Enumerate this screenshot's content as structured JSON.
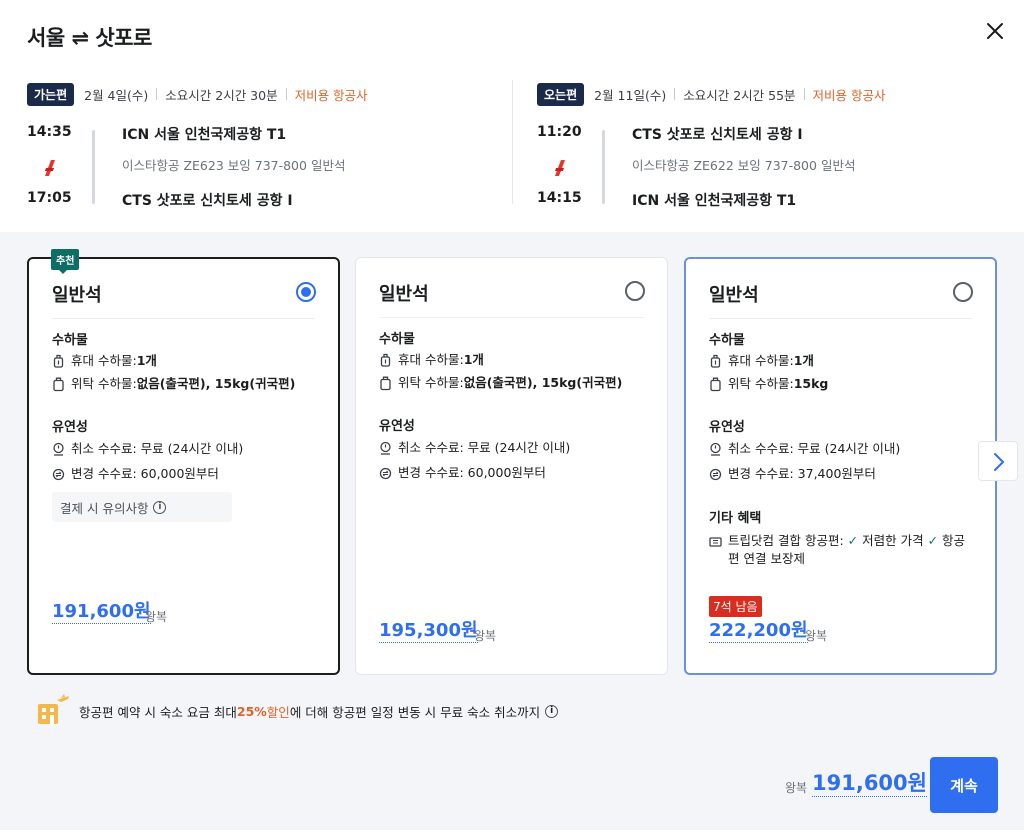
{
  "header": {
    "title": "서울 ⇌ 삿포로",
    "close_icon": "close-icon"
  },
  "outbound": {
    "badge": "가는편",
    "date": "2월 4일(수)",
    "duration": "소요시간 2시간 30분",
    "airline_type": "저비용 항공사",
    "dep_time": "14:35",
    "arr_time": "17:05",
    "dep_airport": "ICN 서울 인천국제공항 T1",
    "arr_airport": "CTS 삿포로 신치토세 공항 I",
    "flight_info": "이스타항공  ZE623  보잉 737-800  일반석"
  },
  "inbound": {
    "badge": "오는편",
    "date": "2월 11일(수)",
    "duration": "소요시간 2시간 55분",
    "airline_type": "저비용 항공사",
    "dep_time": "11:20",
    "arr_time": "14:15",
    "dep_airport": "CTS 삿포로 신치토세 공항 I",
    "arr_airport": "ICN 서울 인천국제공항 T1",
    "flight_info": "이스타항공  ZE622  보잉 737-800  일반석"
  },
  "fares": [
    {
      "recommended_tag": "추천",
      "title": "일반석",
      "selected": true,
      "baggage_title": "수하물",
      "carry_on_label": "휴대 수하물: ",
      "carry_on_value": "1개",
      "checked_label": "위탁 수하물: ",
      "checked_value": "없음(출국편), 15kg(귀국편)",
      "flex_title": "유연성",
      "cancel_fee": "취소 수수료: 무료 (24시간 이내)",
      "change_fee": "변경 수수료: 60,000원부터",
      "note": "결제 시 유의사항",
      "price": "191,600원",
      "price_sub": "왕복"
    },
    {
      "title": "일반석",
      "selected": false,
      "baggage_title": "수하물",
      "carry_on_label": "휴대 수하물: ",
      "carry_on_value": "1개",
      "checked_label": "위탁 수하물: ",
      "checked_value": "없음(출국편), 15kg(귀국편)",
      "flex_title": "유연성",
      "cancel_fee": "취소 수수료: 무료 (24시간 이내)",
      "change_fee": "변경 수수료: 60,000원부터",
      "price": "195,300원",
      "price_sub": "왕복"
    },
    {
      "title": "일반석",
      "selected": false,
      "baggage_title": "수하물",
      "carry_on_label": "휴대 수하물: ",
      "carry_on_value": "1개",
      "checked_label": "위탁 수하물: ",
      "checked_value": "15kg",
      "flex_title": "유연성",
      "cancel_fee": "취소 수수료: 무료 (24시간 이내)",
      "change_fee": "변경 수수료: 37,400원부터",
      "extra_title": "기타 혜택",
      "extra_prefix": "트립닷컴 결합 항공편: ",
      "extra_b1": "저렴한 가격",
      "extra_b2": "항공편 연결 보장제",
      "seats_left": "7석 남음",
      "price": "222,200원",
      "price_sub": "왕복"
    }
  ],
  "promo": {
    "pre": "항공편 예약 시 숙소 요금 최대 ",
    "pct": "25%",
    "mid": " 할인",
    "post": "에 더해 항공편 일정 변동 시 무료 숙소 취소까지"
  },
  "footer": {
    "total_label": "왕복",
    "total_price": "191,600원",
    "cta_label": "계속"
  },
  "colors": {
    "accent": "#2f6fef",
    "lowcost": "#e0642a",
    "recommended": "#0f6e63",
    "seats": "#d92d20"
  }
}
